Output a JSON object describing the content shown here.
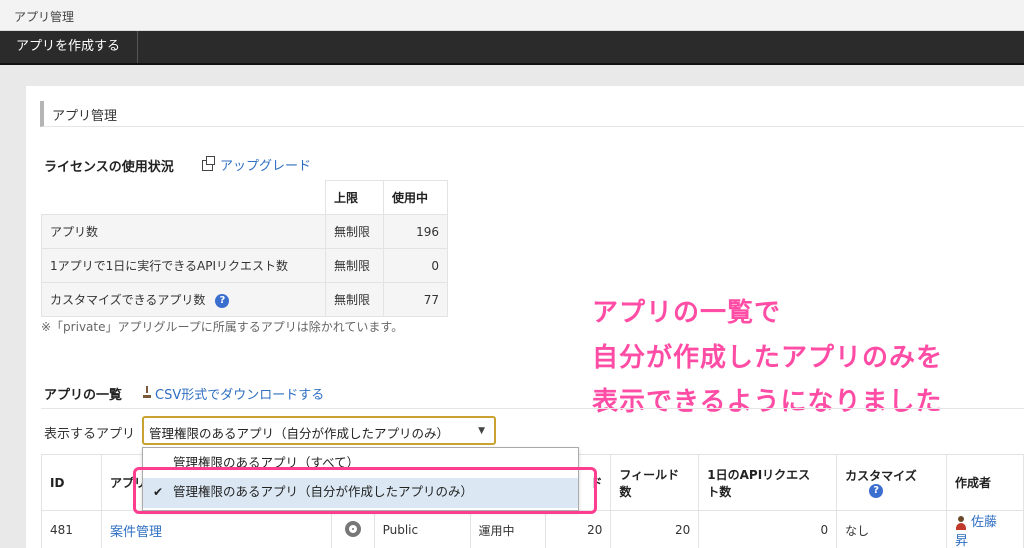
{
  "window": {
    "title": "アプリ管理"
  },
  "toolbar": {
    "create_button": "アプリを作成する"
  },
  "page": {
    "title": "アプリ管理"
  },
  "license": {
    "title": "ライセンスの使用状況",
    "upgrade_link": "アップグレード",
    "columns": [
      "上限",
      "使用中"
    ],
    "rows": [
      {
        "label": "アプリ数",
        "limit": "無制限",
        "used": "196"
      },
      {
        "label": "1アプリで1日に実行できるAPIリクエスト数",
        "limit": "無制限",
        "used": "0"
      },
      {
        "label": "カスタマイズできるアプリ数",
        "limit": "無制限",
        "used": "77"
      }
    ],
    "note": "※「private」アプリグループに所属するアプリは除かれています。"
  },
  "callout": {
    "lines": [
      "アプリの一覧で",
      "自分が作成したアプリのみを",
      "表示できるようになりました"
    ],
    "color": "#ff4da6"
  },
  "app_list": {
    "title": "アプリの一覧",
    "csv_link": "CSV形式でダウンロードする",
    "filter_label": "表示するアプリ",
    "filter_selected": "管理権限のあるアプリ（自分が作成したアプリのみ）",
    "filter_options": [
      {
        "label": "管理権限のあるアプリ（すべて）",
        "selected": false
      },
      {
        "label": "管理権限のあるアプリ（自分が作成したアプリのみ）",
        "selected": true
      }
    ],
    "columns": {
      "id": "ID",
      "name": "アプリ",
      "records": "ド",
      "fields": [
        "フィールド",
        "数"
      ],
      "api": [
        "1日のAPIリクエス",
        "ト数"
      ],
      "customize": "カスタマイズ",
      "creator": "作成者"
    },
    "rows": [
      {
        "id": "481",
        "name": "案件管理",
        "space": "Public",
        "status": "運用中",
        "records": "20",
        "fields": "20",
        "api": "0",
        "customize": "なし",
        "creator": [
          "佐藤",
          "昇"
        ]
      }
    ]
  }
}
